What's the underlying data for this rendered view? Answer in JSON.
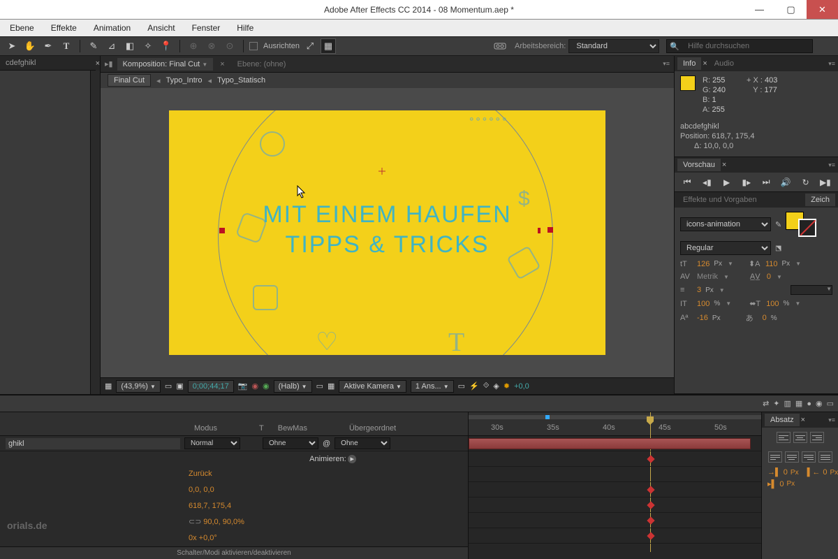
{
  "window": {
    "title": "Adobe After Effects CC 2014 - 08 Momentum.aep *"
  },
  "menu": [
    "Ebene",
    "Effekte",
    "Animation",
    "Ansicht",
    "Fenster",
    "Hilfe"
  ],
  "toolbar": {
    "align_label": "Ausrichten",
    "workspace_label": "Arbeitsbereich:",
    "workspace_value": "Standard",
    "search_placeholder": "Hilfe durchsuchen"
  },
  "project_panel": {
    "tab": "cdefghikl"
  },
  "comp": {
    "tab_label": "Komposition: Final Cut",
    "layer_tab": "Ebene: (ohne)",
    "crumbs": [
      "Final Cut",
      "Typo_Intro",
      "Typo_Statisch"
    ],
    "canvas_line1": "MIT EINEM HAUFEN",
    "canvas_line2": "TIPPS & TRICKS",
    "status": {
      "zoom": "(43,9%)",
      "timecode": "0;00;44;17",
      "resolution": "(Halb)",
      "camera": "Aktive Kamera",
      "views": "1 Ans...",
      "exposure": "+0,0"
    }
  },
  "info": {
    "tab": "Info",
    "tab2": "Audio",
    "R": "255",
    "G": "240",
    "B": "1",
    "A": "255",
    "X": "403",
    "Y": "177",
    "sel_name": "abcdefghikl",
    "sel_pos_label": "Position:",
    "sel_pos": "618,7, 175,4",
    "sel_delta_label": "Δ:",
    "sel_delta": "10,0, 0,0"
  },
  "preview": {
    "tab": "Vorschau"
  },
  "char": {
    "tab1": "Effekte und Vorgaben",
    "tab2": "Zeich",
    "font": "icons-animation",
    "style": "Regular",
    "size": "126",
    "leading": "110",
    "kerning": "Metrik",
    "tracking": "0",
    "stroke_w": "3",
    "vscale": "100",
    "hscale": "100",
    "baseline": "-16",
    "tsume": "0"
  },
  "absatz": {
    "tab": "Absatz",
    "indent": "0"
  },
  "timeline": {
    "animate_btn": "Animieren:",
    "head_mode": "Modus",
    "head_t": "T",
    "head_trkmat": "BewMas",
    "head_parent": "Übergeordnet",
    "layer_name": "ghikl",
    "mode": "Normal",
    "trkmat": "Ohne",
    "parent": "Ohne",
    "zuruck": "Zurück",
    "anchor": "0,0, 0,0",
    "position": "618,7, 175,4",
    "scale": "90,0, 90,0%",
    "rotation": "0x +0,0°",
    "switches": "Schalter/Modi aktivieren/deaktivieren",
    "watermark": "orials.de",
    "ticks": [
      "30s",
      "35s",
      "40s",
      "45s",
      "50s"
    ]
  }
}
